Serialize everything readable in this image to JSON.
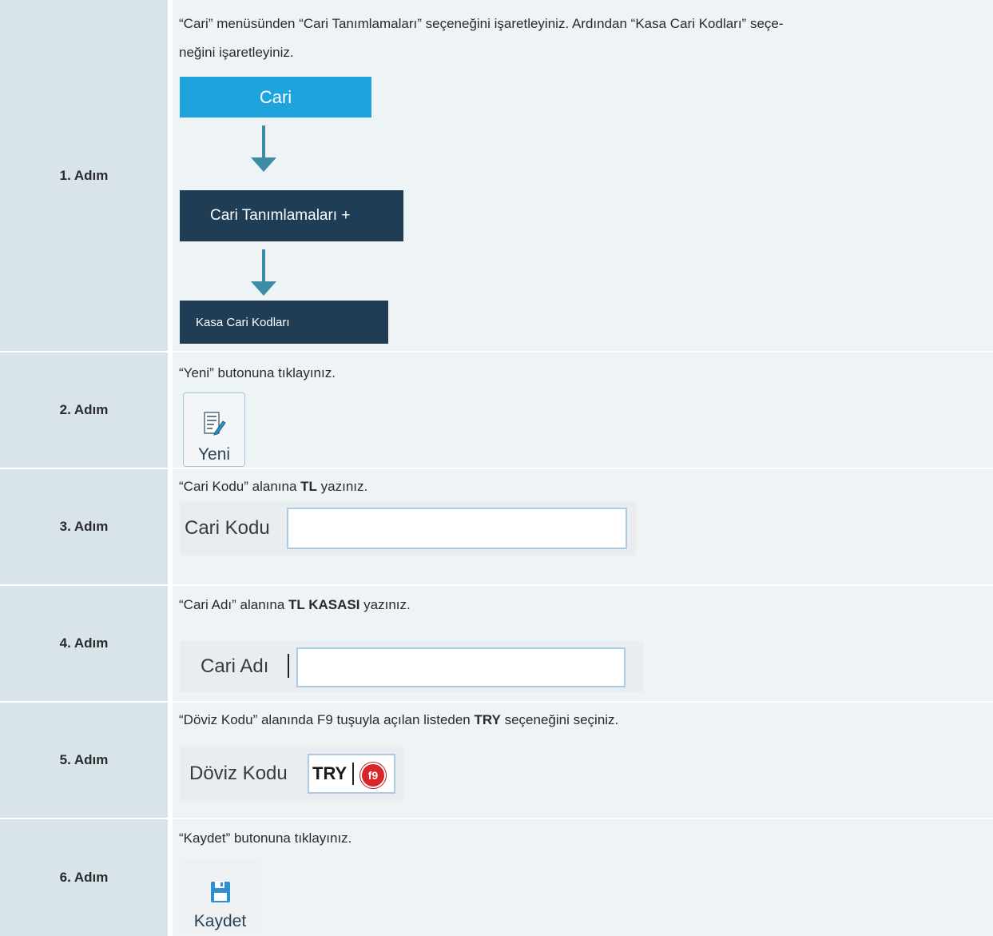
{
  "steps": [
    {
      "label": "1. Adım",
      "instruction_line1": "“Cari” menüsünden “Cari Tanımlamaları” seçeneğini işaretleyiniz. Ardından “Kasa Cari Kodları” seçe-",
      "instruction_line2": "neğini işaretleyiniz.",
      "menu": {
        "cari": "Cari",
        "cari_tanimlamalari": "Cari Tanımlamaları +",
        "kasa_cari_kodlari": "Kasa Cari Kodları"
      }
    },
    {
      "label": "2. Adım",
      "instruction": "“Yeni” butonuna tıklayınız.",
      "button_label": "Yeni",
      "icon": "new-document-icon"
    },
    {
      "label": "3. Adım",
      "instruction_pre": "“Cari Kodu” alanına ",
      "instruction_bold": "TL",
      "instruction_post": " yazınız.",
      "field_label": "Cari Kodu",
      "field_value": ""
    },
    {
      "label": "4. Adım",
      "instruction_pre": "“Cari Adı” alanına ",
      "instruction_bold": "TL KASASI",
      "instruction_post": " yazınız.",
      "field_label": "Cari Adı",
      "field_value": ""
    },
    {
      "label": "5. Adım",
      "instruction_pre": "“Döviz Kodu” alanında F9 tuşuyla açılan listeden ",
      "instruction_bold": "TRY",
      "instruction_post": " seçeneğini seçiniz.",
      "field_label": "Döviz Kodu",
      "field_value": "TRY",
      "badge": "f9"
    },
    {
      "label": "6. Adım",
      "instruction": "“Kaydet” butonuna tıklayınız.",
      "button_label": "Kaydet",
      "icon": "save-disk-icon"
    }
  ],
  "colors": {
    "label_bg": "#d8e3ea",
    "content_bg": "#eef3f6",
    "menu_blue": "#1ea3dd",
    "menu_dark": "#1f3d55",
    "arrow": "#3d8ca6",
    "f9_red": "#d8262b"
  }
}
